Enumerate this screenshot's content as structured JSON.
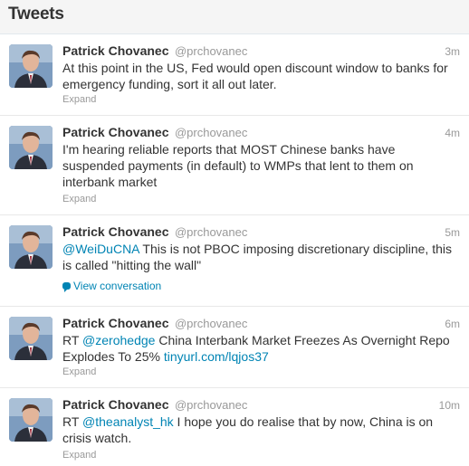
{
  "header": {
    "title": "Tweets"
  },
  "tweets": [
    {
      "fullname": "Patrick Chovanec",
      "username": "@prchovanec",
      "time": "3m",
      "text_lines": [
        "At this point in the US, Fed would open discount window to banks for",
        "emergency funding, sort it all out later."
      ],
      "expand": "Expand"
    },
    {
      "fullname": "Patrick Chovanec",
      "username": "@prchovanec",
      "time": "4m",
      "text_lines": [
        "I'm hearing reliable reports that MOST Chinese banks have",
        "suspended payments (in default) to WMPs that lent to them on",
        "interbank market"
      ],
      "expand": "Expand"
    },
    {
      "fullname": "Patrick Chovanec",
      "username": "@prchovanec",
      "time": "5m",
      "mention": "@WeiDuCNA",
      "text_after_mention_line1": " This is not PBOC imposing discretionary discipline, this",
      "text_line2": "is called \"hitting the wall\"",
      "view_conversation": "View conversation"
    },
    {
      "fullname": "Patrick Chovanec",
      "username": "@prchovanec",
      "time": "6m",
      "prefix": "RT ",
      "mention": "@zerohedge",
      "text_after_mention_line1": " China Interbank Market Freezes As Overnight Repo",
      "text_line2_prefix": "Explodes To 25% ",
      "link": "tinyurl.com/lqjos37",
      "expand": "Expand"
    },
    {
      "fullname": "Patrick Chovanec",
      "username": "@prchovanec",
      "time": "10m",
      "prefix": "RT ",
      "mention": "@theanalyst_hk",
      "text_after_mention_line1": " I hope you do realise that by now, China is on",
      "text_line2": "crisis watch.",
      "expand": "Expand"
    }
  ]
}
